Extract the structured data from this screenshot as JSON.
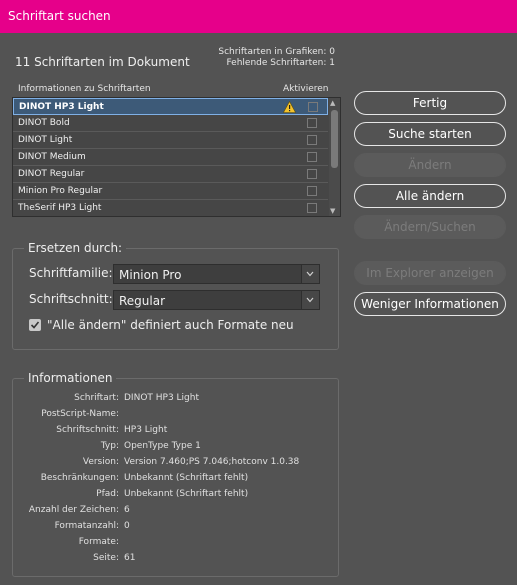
{
  "window": {
    "title": "Schriftart suchen"
  },
  "header": {
    "doc_fonts": "11 Schriftarten im Dokument",
    "in_graphics": "Schriftarten in Grafiken: 0",
    "missing": "Fehlende Schriftarten: 1"
  },
  "font_list": {
    "col_info": "Informationen zu Schriftarten",
    "col_activate": "Aktivieren",
    "rows": [
      {
        "name": "DINOT HP3 Light",
        "selected": true,
        "warning": true
      },
      {
        "name": "DINOT Bold"
      },
      {
        "name": "DINOT Light"
      },
      {
        "name": "DINOT Medium"
      },
      {
        "name": "DINOT Regular"
      },
      {
        "name": "Minion Pro Regular"
      },
      {
        "name": "TheSerif HP3 Light"
      }
    ]
  },
  "buttons": {
    "done": "Fertig",
    "find": "Suche starten",
    "change": "Ändern",
    "change_all": "Alle ändern",
    "change_find": "Ändern/Suchen",
    "reveal": "Im Explorer anzeigen",
    "less_info": "Weniger Informationen"
  },
  "replace": {
    "title": "Ersetzen durch:",
    "family_label": "Schriftfamilie:",
    "family_value": "Minion Pro",
    "style_label": "Schriftschnitt:",
    "style_value": "Regular",
    "redefine_label": "\"Alle ändern\" definiert auch Formate neu",
    "redefine_checked": true
  },
  "info": {
    "title": "Informationen",
    "rows": [
      {
        "label": "Schriftart:",
        "value": "DINOT HP3 Light"
      },
      {
        "label": "PostScript-Name:",
        "value": ""
      },
      {
        "label": "Schriftschnitt:",
        "value": "HP3 Light"
      },
      {
        "label": "Typ:",
        "value": "OpenType Type 1"
      },
      {
        "label": "Version:",
        "value": "Version 7.460;PS 7.046;hotconv 1.0.38"
      },
      {
        "label": "Beschränkungen:",
        "value": "Unbekannt (Schriftart fehlt)"
      },
      {
        "label": "Pfad:",
        "value": "Unbekannt (Schriftart fehlt)"
      },
      {
        "label": "Anzahl der Zeichen:",
        "value": "6"
      },
      {
        "label": "Formatanzahl:",
        "value": "0"
      },
      {
        "label": "Formate:",
        "value": ""
      },
      {
        "label": "Seite:",
        "value": "61"
      }
    ]
  },
  "colors": {
    "accent": "#e6008a",
    "selection": "#3d5a78",
    "warning": "#f2c22e"
  },
  "icons": {
    "warning": "warning-triangle-icon",
    "dropdown": "chevron-down-icon",
    "check": "checkmark-icon"
  }
}
